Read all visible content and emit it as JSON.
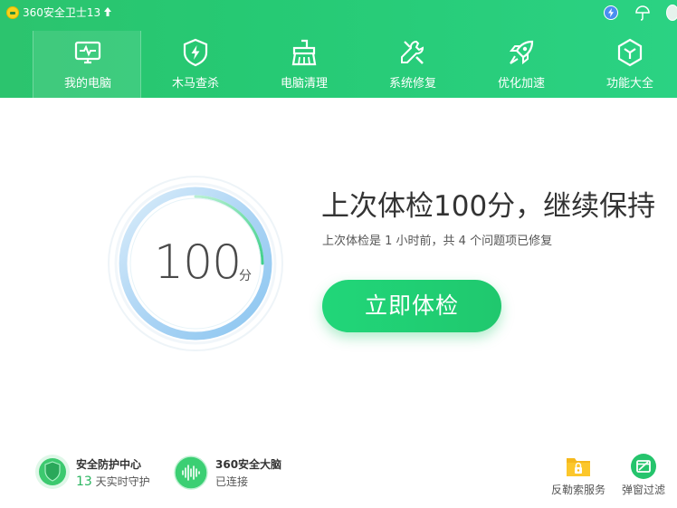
{
  "app": {
    "title": "360安全卫士13"
  },
  "titlebar": {
    "upgrade_icon": "arrow-up-icon",
    "speed_icon": "lightning-circle-icon",
    "skin_icon": "umbrella-icon",
    "avatar_icon": "avatar-icon"
  },
  "nav": {
    "items": [
      {
        "label": "我的电脑",
        "icon": "monitor-pulse-icon",
        "active": true
      },
      {
        "label": "木马查杀",
        "icon": "shield-bolt-icon",
        "active": false
      },
      {
        "label": "电脑清理",
        "icon": "broom-icon",
        "active": false
      },
      {
        "label": "系统修复",
        "icon": "wrench-screwdriver-icon",
        "active": false
      },
      {
        "label": "优化加速",
        "icon": "rocket-icon",
        "active": false
      },
      {
        "label": "功能大全",
        "icon": "cube-icon",
        "active": false
      }
    ]
  },
  "checkup": {
    "score": "100",
    "score_unit": "分",
    "headline": "上次体检100分，继续保持",
    "subline": "上次体检是 1 小时前，共 4 个问题项已修复",
    "button_label": "立即体检"
  },
  "footer": {
    "protection": {
      "title": "安全防护中心",
      "days": "13",
      "days_text": "天实时守护",
      "icon": "shield-check-icon"
    },
    "brain": {
      "title": "360安全大脑",
      "status": "已连接",
      "icon": "sound-wave-icon"
    },
    "tools": [
      {
        "label": "反勒索服务",
        "icon": "folder-lock-icon"
      },
      {
        "label": "弹窗过滤",
        "icon": "popup-filter-icon"
      }
    ]
  },
  "colors": {
    "brand_green": "#26c973",
    "button_green": "#21d679",
    "text_dark": "#333333",
    "accent_days": "#2ab560"
  }
}
